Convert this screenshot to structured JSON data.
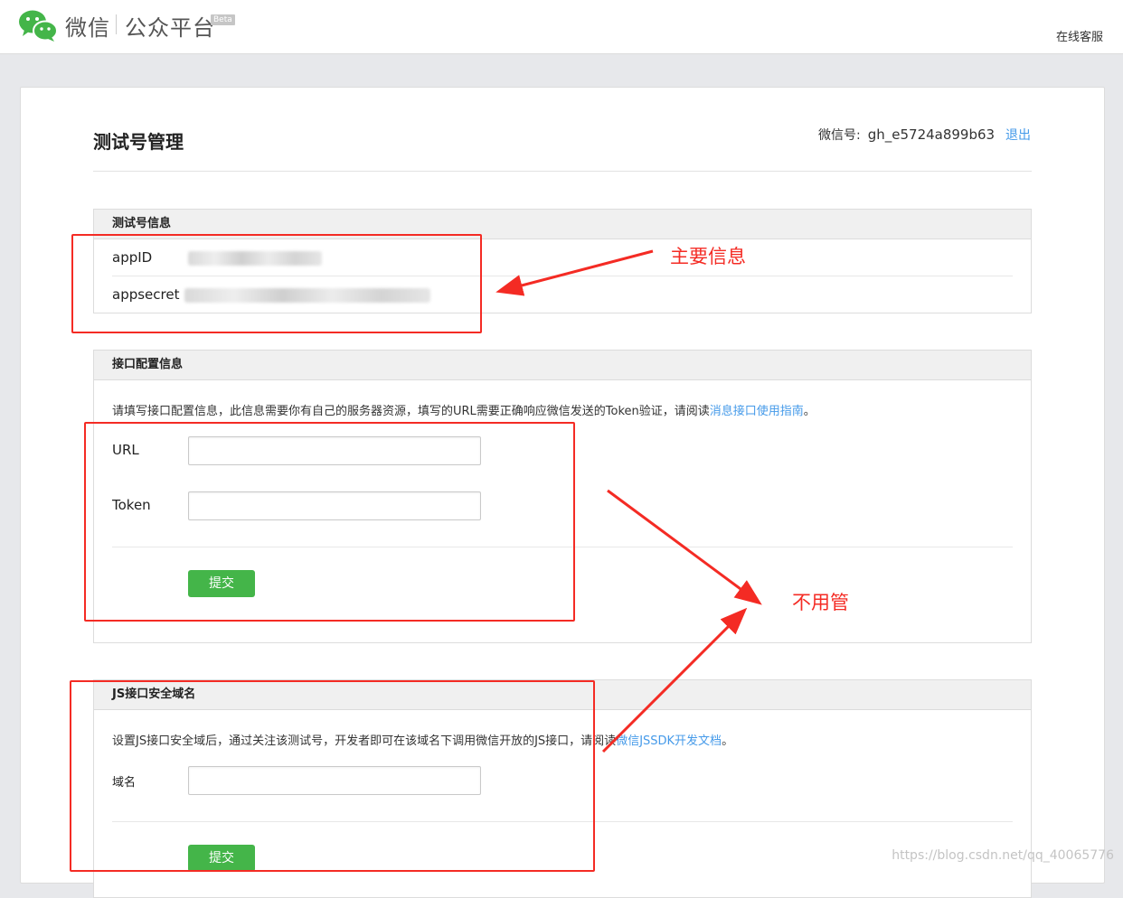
{
  "brand": {
    "name": "微信",
    "product": "公众平台",
    "badge": "Beta"
  },
  "topbar": {
    "service_link": "在线客服"
  },
  "page": {
    "title": "测试号管理"
  },
  "account": {
    "label": "微信号:",
    "value": "gh_e5724a899b63",
    "logout": "退出"
  },
  "test_account_section": {
    "title": "测试号信息",
    "rows": [
      {
        "label": "appID"
      },
      {
        "label": "appsecret"
      }
    ]
  },
  "interface_section": {
    "title": "接口配置信息",
    "description": "请填写接口配置信息，此信息需要你有自己的服务器资源，填写的URL需要正确响应微信发送的Token验证，请阅读",
    "description_link": "消息接口使用指南",
    "description_end": "。",
    "fields": [
      {
        "label": "URL",
        "value": ""
      },
      {
        "label": "Token",
        "value": ""
      }
    ],
    "submit": "提交"
  },
  "js_section": {
    "title": "JS接口安全域名",
    "description": "设置JS接口安全域后，通过关注该测试号，开发者即可在该域名下调用微信开放的JS接口，请阅读",
    "description_link": "微信JSSDK开发文档",
    "description_end": "。",
    "field": {
      "label": "域名",
      "value": ""
    },
    "submit": "提交"
  },
  "annotations": {
    "main_info": "主要信息",
    "ignore": "不用管"
  },
  "watermark": "https://blog.csdn.net/qq_40065776",
  "colors": {
    "accent_green": "#44b549",
    "link_blue": "#459ae9",
    "annotation_red": "#f42b24"
  }
}
